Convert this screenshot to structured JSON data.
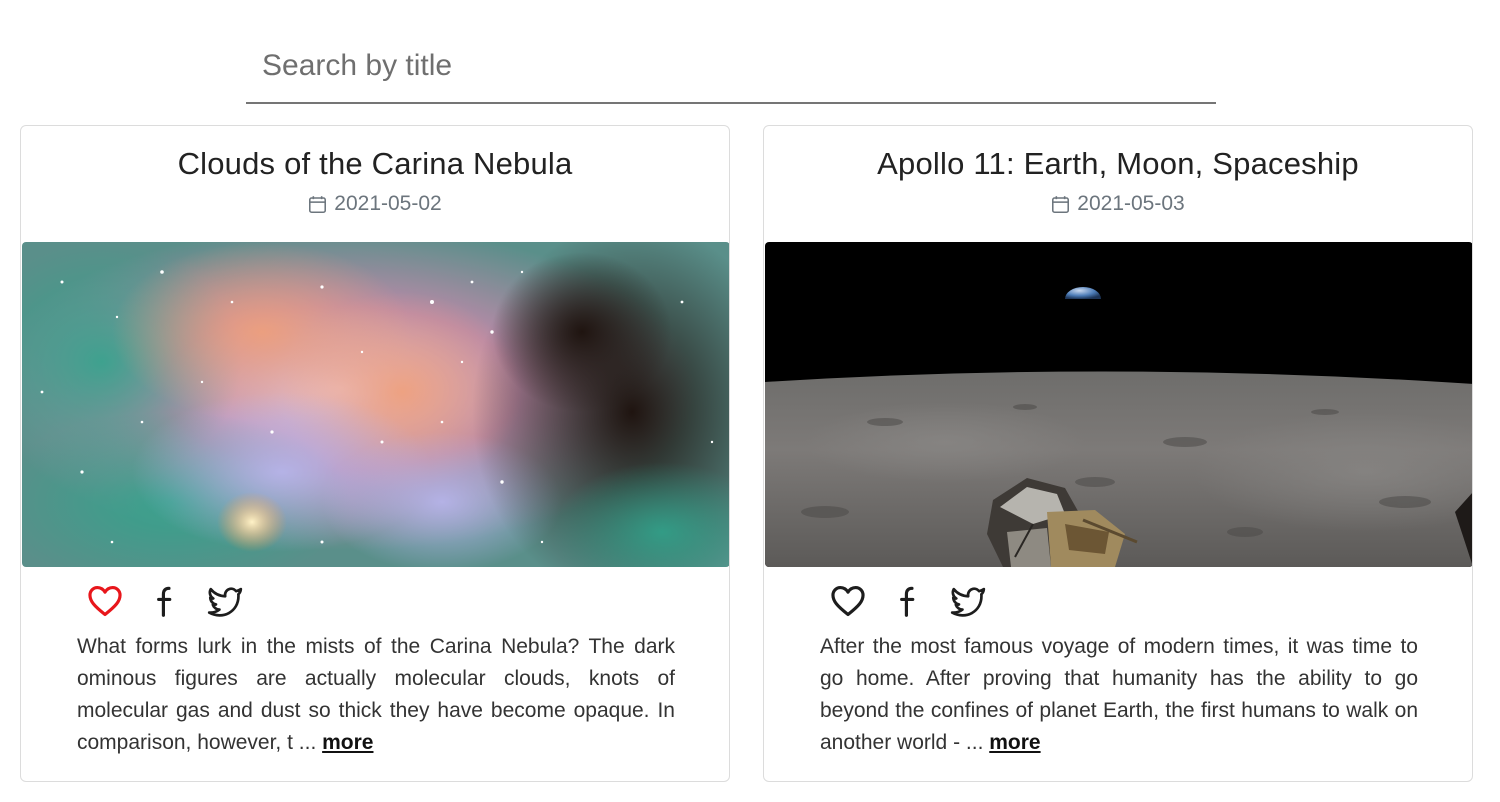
{
  "search": {
    "placeholder": "Search by title",
    "value": ""
  },
  "cards": [
    {
      "title": "Clouds of the Carina Nebula",
      "date": "2021-05-02",
      "liked": true,
      "description": "What forms lurk in the mists of the Carina Nebula? The dark ominous figures are actually molecular clouds, knots of molecular gas and dust so thick they have become opaque. In comparison, however, t ...",
      "more_label": "more",
      "icons": {
        "like": "heart-icon",
        "share_facebook": "facebook-icon",
        "share_twitter": "twitter-icon",
        "date": "calendar-icon"
      }
    },
    {
      "title": "Apollo 11: Earth, Moon, Spaceship",
      "date": "2021-05-03",
      "liked": false,
      "description": "After the most famous voyage of modern times, it was time to go home. After proving that humanity has the ability to go beyond the confines of planet Earth, the first humans to walk on another world - ...",
      "more_label": "more",
      "icons": {
        "like": "heart-icon",
        "share_facebook": "facebook-icon",
        "share_twitter": "twitter-icon",
        "date": "calendar-icon"
      }
    }
  ],
  "colors": {
    "liked_heart": "#e8161b",
    "icon": "#1d1d1d",
    "date_text": "#6c757d",
    "search_underline": "#757575"
  }
}
